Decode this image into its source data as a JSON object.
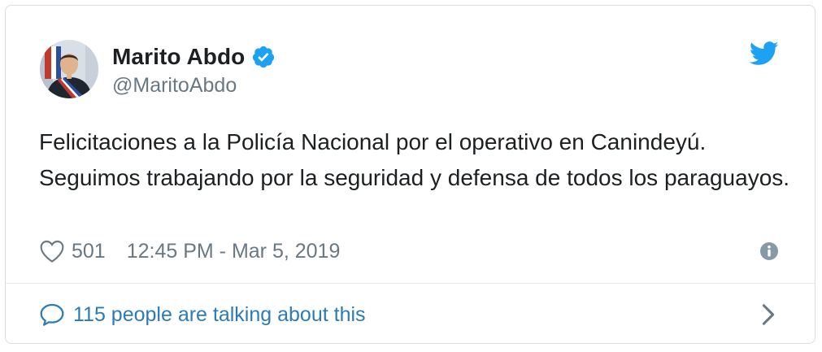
{
  "tweet": {
    "author": {
      "display_name": "Marito Abdo",
      "handle": "@MaritoAbdo",
      "verified": true
    },
    "text": "Felicitaciones a la Policía Nacional por el operativo en Canindeyú. Seguimos trabajando por la seguridad y defensa de todos los paraguayos.",
    "likes": "501",
    "timestamp": "12:45 PM - Mar 5, 2019",
    "conversation_text": "115 people are talking about this"
  },
  "icons": {
    "verified": "verified-badge-icon",
    "brand": "twitter-bird-icon",
    "like": "heart-icon",
    "info": "info-icon",
    "reply": "speech-bubble-icon",
    "more": "chevron-right-icon"
  },
  "colors": {
    "brand_blue": "#1da1f2",
    "link_blue": "#2b7bb9",
    "muted_text": "#697882",
    "primary_text": "#1c2022",
    "border": "#d8dee2"
  }
}
